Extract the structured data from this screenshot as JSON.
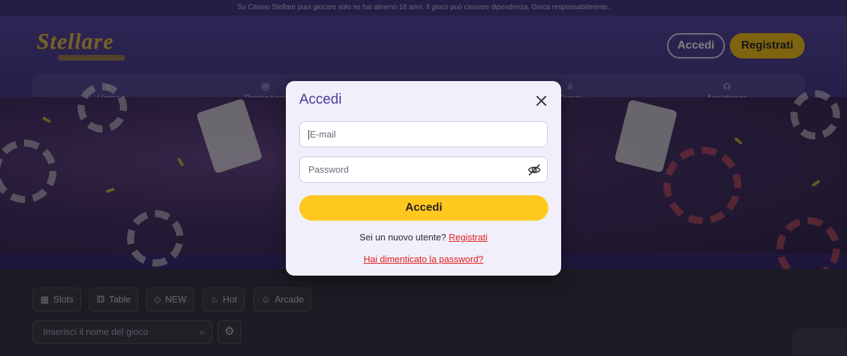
{
  "topbar": {
    "text": "Su Casino Stellare puoi giocare solo se hai almeno 18 anni. Il gioco può causare dipendenza. Gioca responsabilmente."
  },
  "header": {
    "logo_text": "Stellare",
    "login_label": "Accedi",
    "register_label": "Registrati"
  },
  "nav": {
    "items": [
      {
        "label": "Home",
        "icon": "home-icon"
      },
      {
        "label": "Promozioni",
        "icon": "gift-icon"
      },
      {
        "label": "Tornei",
        "icon": "trophy-icon"
      },
      {
        "label": "Assistenza",
        "icon": "headset-icon"
      }
    ]
  },
  "filters": {
    "chips": [
      {
        "label": "Slots",
        "icon": "slot-icon"
      },
      {
        "label": "Table",
        "icon": "dice-icon"
      },
      {
        "label": "NEW",
        "icon": "diamond-icon"
      },
      {
        "label": "Hot",
        "icon": "flame-icon"
      },
      {
        "label": "Arcade",
        "icon": "user-icon"
      }
    ],
    "search_placeholder": "Inserisci il nome del gioco"
  },
  "modal": {
    "title": "Accedi",
    "email_placeholder": "E-mail",
    "password_placeholder": "Password",
    "submit_label": "Accedi",
    "new_user_text": "Sei un nuovo utente?",
    "register_link": "Registrati",
    "forgot_link": "Hai dimenticato la password?"
  },
  "colors": {
    "accent_yellow": "#ffc81f",
    "modal_title": "#4b3c9a",
    "link_red": "#e01e1e"
  }
}
